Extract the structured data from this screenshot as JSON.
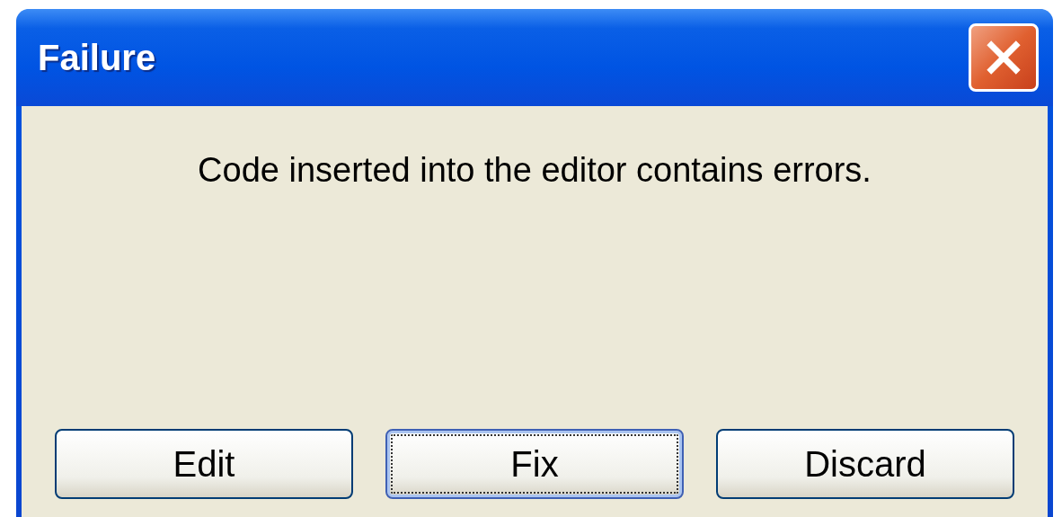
{
  "window": {
    "title": "Failure"
  },
  "message": "Code inserted into the editor contains errors.",
  "buttons": [
    {
      "label": "Edit",
      "focused": false
    },
    {
      "label": "Fix",
      "focused": true
    },
    {
      "label": "Discard",
      "focused": false
    }
  ]
}
